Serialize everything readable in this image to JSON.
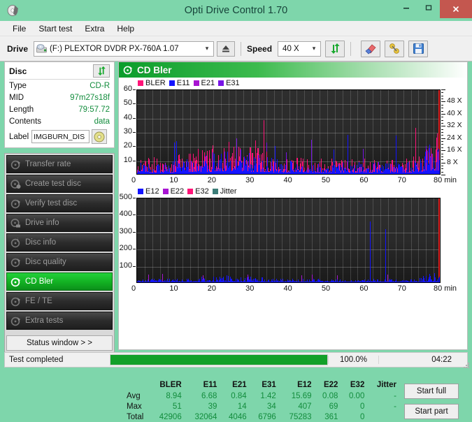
{
  "window": {
    "title": "Opti Drive Control 1.70",
    "app_icon": "disc-icon",
    "minimize": "—",
    "maximize": "□",
    "close": "✕"
  },
  "menu": {
    "items": [
      {
        "label": "File"
      },
      {
        "label": "Start test"
      },
      {
        "label": "Extra"
      },
      {
        "label": "Help"
      }
    ]
  },
  "toolbar": {
    "drive_label": "Drive",
    "drive_value": "(F:)   PLEXTOR DVDR   PX-760A 1.07",
    "eject_icon": "eject-icon",
    "speed_label": "Speed",
    "speed_value": "40 X",
    "refresh_icon": "refresh-icon",
    "eraser_icon": "eraser-icon",
    "tools_icon": "tools-icon",
    "save_icon": "save-icon"
  },
  "disc": {
    "title": "Disc",
    "refresh_icon": "refresh-icon",
    "rows": [
      {
        "key": "Type",
        "value": "CD-R"
      },
      {
        "key": "MID",
        "value": "97m27s18f"
      },
      {
        "key": "Length",
        "value": "79:57.72"
      },
      {
        "key": "Contents",
        "value": "data"
      }
    ],
    "label_key": "Label",
    "label_value": "IMGBURN_DIS",
    "label_icon": "cd-icon"
  },
  "nav": {
    "items": [
      {
        "label": "Transfer rate",
        "icon": "disc-test-icon",
        "active": false
      },
      {
        "label": "Create test disc",
        "icon": "disc-create-icon",
        "active": false
      },
      {
        "label": "Verify test disc",
        "icon": "disc-verify-icon",
        "active": false
      },
      {
        "label": "Drive info",
        "icon": "disc-drive-icon",
        "active": false
      },
      {
        "label": "Disc info",
        "icon": "disc-info-icon",
        "active": false
      },
      {
        "label": "Disc quality",
        "icon": "disc-quality-icon",
        "active": false
      },
      {
        "label": "CD Bler",
        "icon": "disc-bler-icon",
        "active": true
      },
      {
        "label": "FE / TE",
        "icon": "disc-fete-icon",
        "active": false
      },
      {
        "label": "Extra tests",
        "icon": "disc-extra-icon",
        "active": false
      }
    ],
    "status_window": "Status window > >"
  },
  "panel": {
    "icon": "disc-bler-icon",
    "title": "CD Bler"
  },
  "actions": {
    "start_full": "Start full",
    "start_part": "Start part"
  },
  "stats": {
    "columns": [
      "BLER",
      "E11",
      "E21",
      "E31",
      "E12",
      "E22",
      "E32",
      "Jitter"
    ],
    "rows": [
      {
        "label": "Avg",
        "values": [
          "8.94",
          "6.68",
          "0.84",
          "1.42",
          "15.69",
          "0.08",
          "0.00",
          "-"
        ]
      },
      {
        "label": "Max",
        "values": [
          "51",
          "39",
          "14",
          "34",
          "407",
          "69",
          "0",
          "-"
        ]
      },
      {
        "label": "Total",
        "values": [
          "42906",
          "32064",
          "4046",
          "6796",
          "75283",
          "361",
          "0",
          ""
        ]
      }
    ]
  },
  "status": {
    "text": "Test completed",
    "percent_label": "100.0%",
    "percent_value": 100,
    "time": "04:22",
    "bar_color": "#12a029"
  },
  "chart_data": [
    {
      "id": "bler-chart",
      "type": "bar",
      "title": "CD Bler",
      "xlabel": "min",
      "ylabel": "",
      "x_ticks": [
        0,
        10,
        20,
        30,
        40,
        50,
        60,
        70,
        80
      ],
      "x_tick_labels": [
        "0",
        "10",
        "20",
        "30",
        "40",
        "50",
        "60",
        "70",
        "80 min"
      ],
      "xlim": [
        0,
        80
      ],
      "y_ticks": [
        10,
        20,
        30,
        40,
        50,
        60
      ],
      "y_tick_labels": [
        "10",
        "20",
        "30",
        "40",
        "50",
        "60"
      ],
      "ylim": [
        0,
        60
      ],
      "right_axis": {
        "label": "X",
        "ticks": [
          8,
          16,
          24,
          32,
          40,
          48
        ],
        "tick_labels": [
          "8 X",
          "16 X",
          "24 X",
          "32 X",
          "40 X",
          "48 X"
        ],
        "lim": [
          0,
          56
        ]
      },
      "grid": true,
      "legend_position": "top-left",
      "legend": [
        {
          "name": "BLER",
          "color": "#ff1478"
        },
        {
          "name": "E11",
          "color": "#1414ff"
        },
        {
          "name": "E21",
          "color": "#a814d2"
        },
        {
          "name": "E31",
          "color": "#7814e6"
        }
      ],
      "series": [
        {
          "name": "BLER",
          "color": "#ff1478",
          "avg": 8.94,
          "max": 51,
          "total": 42906
        },
        {
          "name": "E11",
          "color": "#1414ff",
          "avg": 6.68,
          "max": 39,
          "total": 32064
        },
        {
          "name": "E21",
          "color": "#a814d2",
          "avg": 0.84,
          "max": 14,
          "total": 4046
        },
        {
          "name": "E31",
          "color": "#7814e6",
          "avg": 1.42,
          "max": 34,
          "total": 6796
        }
      ]
    },
    {
      "id": "e12-chart",
      "type": "bar",
      "title": "",
      "xlabel": "min",
      "ylabel": "",
      "x_ticks": [
        0,
        10,
        20,
        30,
        40,
        50,
        60,
        70,
        80
      ],
      "x_tick_labels": [
        "0",
        "10",
        "20",
        "30",
        "40",
        "50",
        "60",
        "70",
        "80 min"
      ],
      "xlim": [
        0,
        80
      ],
      "y_ticks": [
        100,
        200,
        300,
        400,
        500
      ],
      "y_tick_labels": [
        "100",
        "200",
        "300",
        "400",
        "500"
      ],
      "ylim": [
        0,
        500
      ],
      "grid": true,
      "legend_position": "top-left",
      "legend": [
        {
          "name": "E12",
          "color": "#1414ff"
        },
        {
          "name": "E22",
          "color": "#a814d2"
        },
        {
          "name": "E32",
          "color": "#ff1478"
        },
        {
          "name": "Jitter",
          "color": "#3c7d78"
        }
      ],
      "series": [
        {
          "name": "E12",
          "color": "#1414ff",
          "avg": 15.69,
          "max": 407,
          "total": 75283
        },
        {
          "name": "E22",
          "color": "#a814d2",
          "avg": 0.08,
          "max": 69,
          "total": 361
        },
        {
          "name": "E32",
          "color": "#ff1478",
          "avg": 0.0,
          "max": 0,
          "total": 0
        },
        {
          "name": "Jitter",
          "color": "#3c7d78",
          "avg": "-",
          "max": "-",
          "total": ""
        }
      ]
    }
  ]
}
